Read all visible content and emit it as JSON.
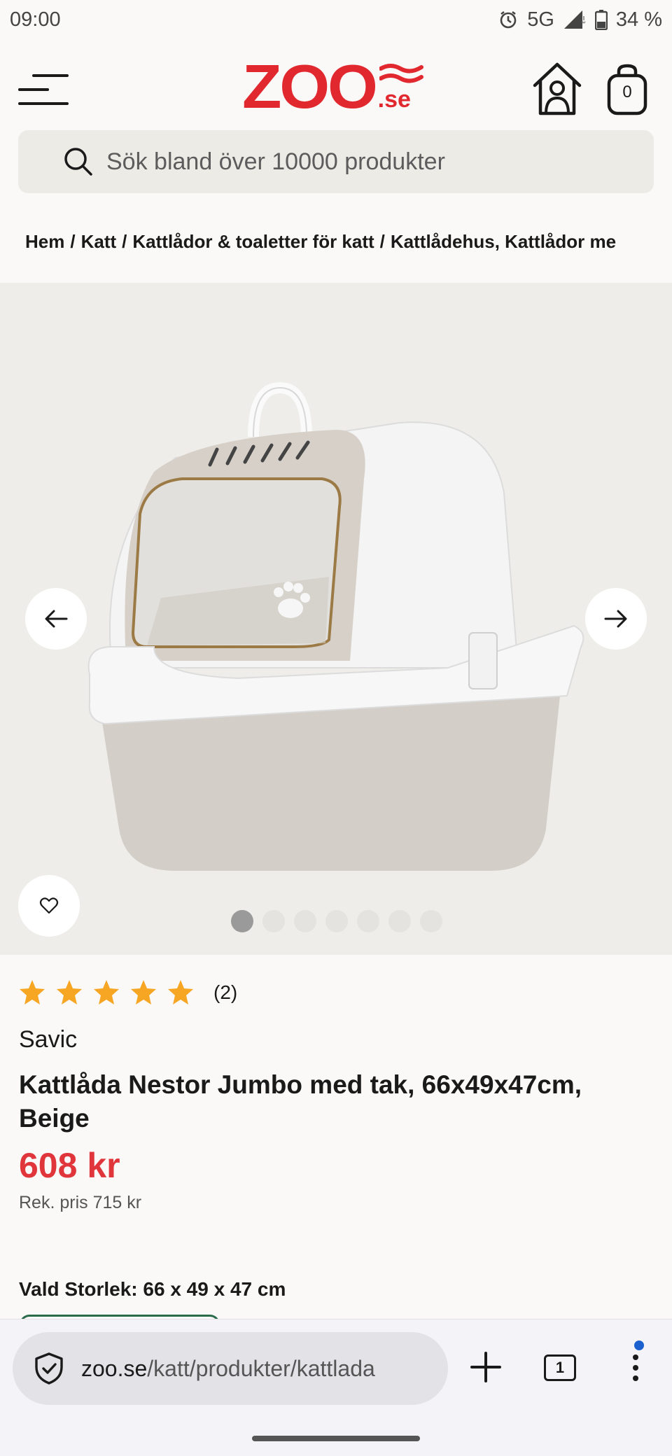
{
  "status_bar": {
    "time": "09:00",
    "network": "5G",
    "battery": "34 %",
    "icons": [
      "alarm-icon",
      "signal-icon",
      "battery-icon"
    ]
  },
  "header": {
    "logo_text": "ZOO",
    "logo_suffix": ".se",
    "cart_count": "0",
    "icons": [
      "menu-icon",
      "home-icon",
      "cart-icon"
    ]
  },
  "search": {
    "placeholder": "Sök bland över 10000 produkter"
  },
  "breadcrumb": [
    "Hem",
    "Katt",
    "Kattlådor & toaletter för katt",
    "Kattlådehus, Kattlådor me"
  ],
  "gallery": {
    "image_count": 7,
    "active_index": 0
  },
  "product": {
    "rating_stars": 5,
    "rating_count": "(2)",
    "brand": "Savic",
    "title": "Kattlåda Nestor Jumbo med tak, 66x49x47cm, Beige",
    "price": "608 kr",
    "rek_price": "Rek. pris 715 kr",
    "size_label": "Vald Storlek:",
    "size_value": "66 x 49 x 47 cm"
  },
  "browser": {
    "url_domain": "zoo.se",
    "url_path": "/katt/produkter/kattlada",
    "tab_count": "1"
  },
  "colors": {
    "brand_red": "#e2282f",
    "price_red": "#e0353b",
    "star_orange": "#f6a623",
    "accent_green": "#2a6b4c"
  }
}
